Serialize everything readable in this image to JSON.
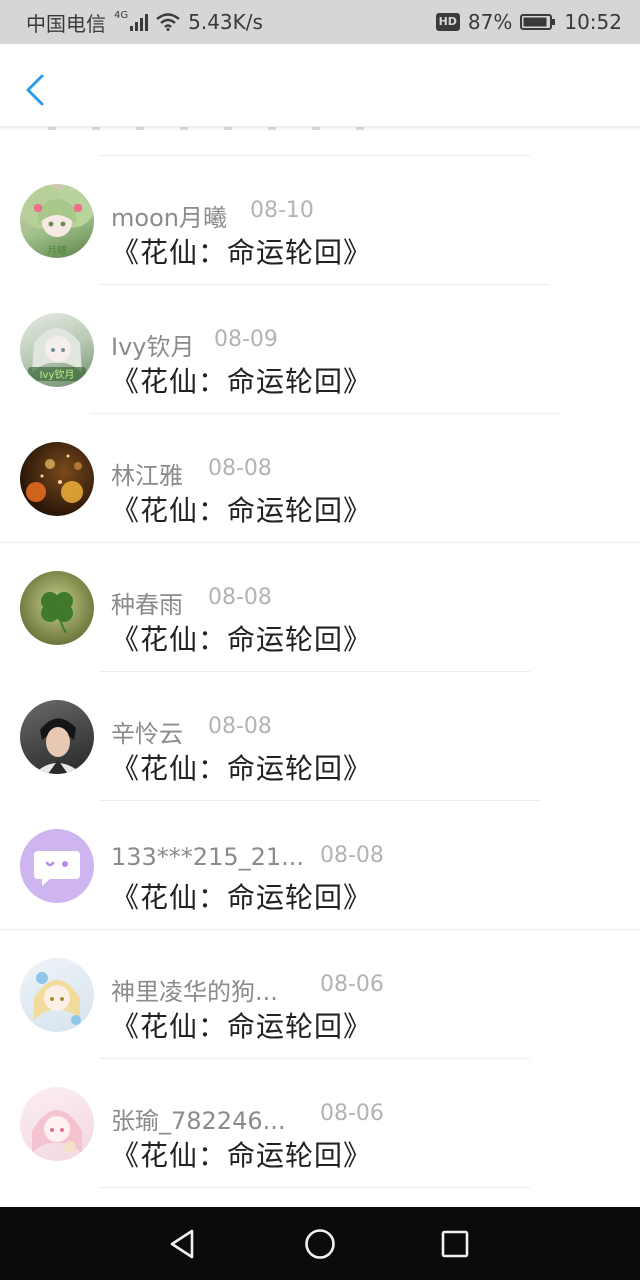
{
  "status_bar": {
    "carrier": "中国电信",
    "network_type": "4G",
    "speed": "5.43K/s",
    "hd_label": "HD",
    "battery": "87%",
    "time": "10:52"
  },
  "title_bar": {
    "back_icon": "chevron-left-icon"
  },
  "items": [
    {
      "name": "moon月曦",
      "date": "08-10",
      "title": "《花仙：命运轮回》",
      "avatar": "anime-girl-green-avatar"
    },
    {
      "name": "Ivy钦月",
      "date": "08-09",
      "title": "《花仙：命运轮回》",
      "avatar": "anime-girl-silver-avatar"
    },
    {
      "name": "林江雅",
      "date": "08-08",
      "title": "《花仙：命运轮回》",
      "avatar": "bokeh-lights-avatar"
    },
    {
      "name": "种春雨",
      "date": "08-08",
      "title": "《花仙：命运轮回》",
      "avatar": "clover-avatar"
    },
    {
      "name": "辛怜云",
      "date": "08-08",
      "title": "《花仙：命运轮回》",
      "avatar": "man-portrait-avatar"
    },
    {
      "name": "133***215_21...",
      "date": "08-08",
      "title": "《花仙：命运轮回》",
      "avatar": "default-chat-avatar"
    },
    {
      "name": "神里凌华的狗...",
      "date": "08-06",
      "title": "《花仙：命运轮回》",
      "avatar": "anime-girl-blonde-avatar"
    },
    {
      "name": "张瑜_782246...",
      "date": "08-06",
      "title": "《花仙：命运轮回》",
      "avatar": "anime-girl-pink-avatar"
    }
  ],
  "colors": {
    "accent": "#2e9be8",
    "name_text": "#8b8b8b",
    "date_text": "#b3b3b3",
    "title_text": "#222222",
    "default_avatar_bg": "#cfb5f0"
  },
  "nav_bar": {
    "back": "triangle-back-icon",
    "home": "circle-home-icon",
    "recents": "square-recents-icon"
  }
}
